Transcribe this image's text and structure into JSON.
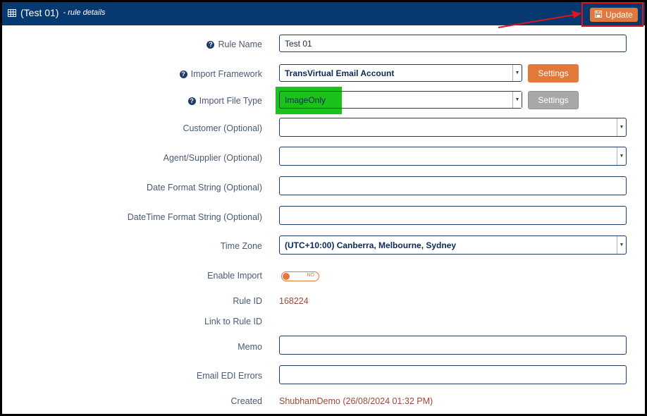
{
  "header": {
    "title": "(Test 01)",
    "subtitle": "- rule details",
    "update_label": "Update"
  },
  "form": {
    "rule_name": {
      "label": "Rule Name",
      "value": "Test 01"
    },
    "import_framework": {
      "label": "Import Framework",
      "value": "TransVirtual Email Account",
      "settings_label": "Settings"
    },
    "import_file_type": {
      "label": "Import File Type",
      "value": "ImageOnly",
      "settings_label": "Settings"
    },
    "customer": {
      "label": "Customer (Optional)",
      "value": ""
    },
    "agent_supplier": {
      "label": "Agent/Supplier (Optional)",
      "value": ""
    },
    "date_format": {
      "label": "Date Format String (Optional)",
      "value": ""
    },
    "datetime_format": {
      "label": "DateTime Format String (Optional)",
      "value": ""
    },
    "time_zone": {
      "label": "Time Zone",
      "value": "(UTC+10:00) Canberra, Melbourne, Sydney"
    },
    "enable_import": {
      "label": "Enable Import",
      "state": "NO"
    },
    "rule_id": {
      "label": "Rule ID",
      "value": "168224"
    },
    "link_rule_id": {
      "label": "Link to Rule ID",
      "value": ""
    },
    "memo": {
      "label": "Memo",
      "value": ""
    },
    "email_edi_errors": {
      "label": "Email EDI Errors",
      "value": ""
    },
    "created": {
      "label": "Created",
      "value": "ShubhamDemo (26/08/2024 01:32 PM)"
    }
  },
  "colors": {
    "header_bg": "#063970",
    "accent_orange": "#e2783b",
    "highlight_green": "#19c319",
    "annotation_red": "#e0141e"
  },
  "icons": {
    "title": "table-grid-icon",
    "update": "save-disk-icon",
    "help": "question-circle-icon",
    "dropdown": "chevron-down-icon"
  }
}
